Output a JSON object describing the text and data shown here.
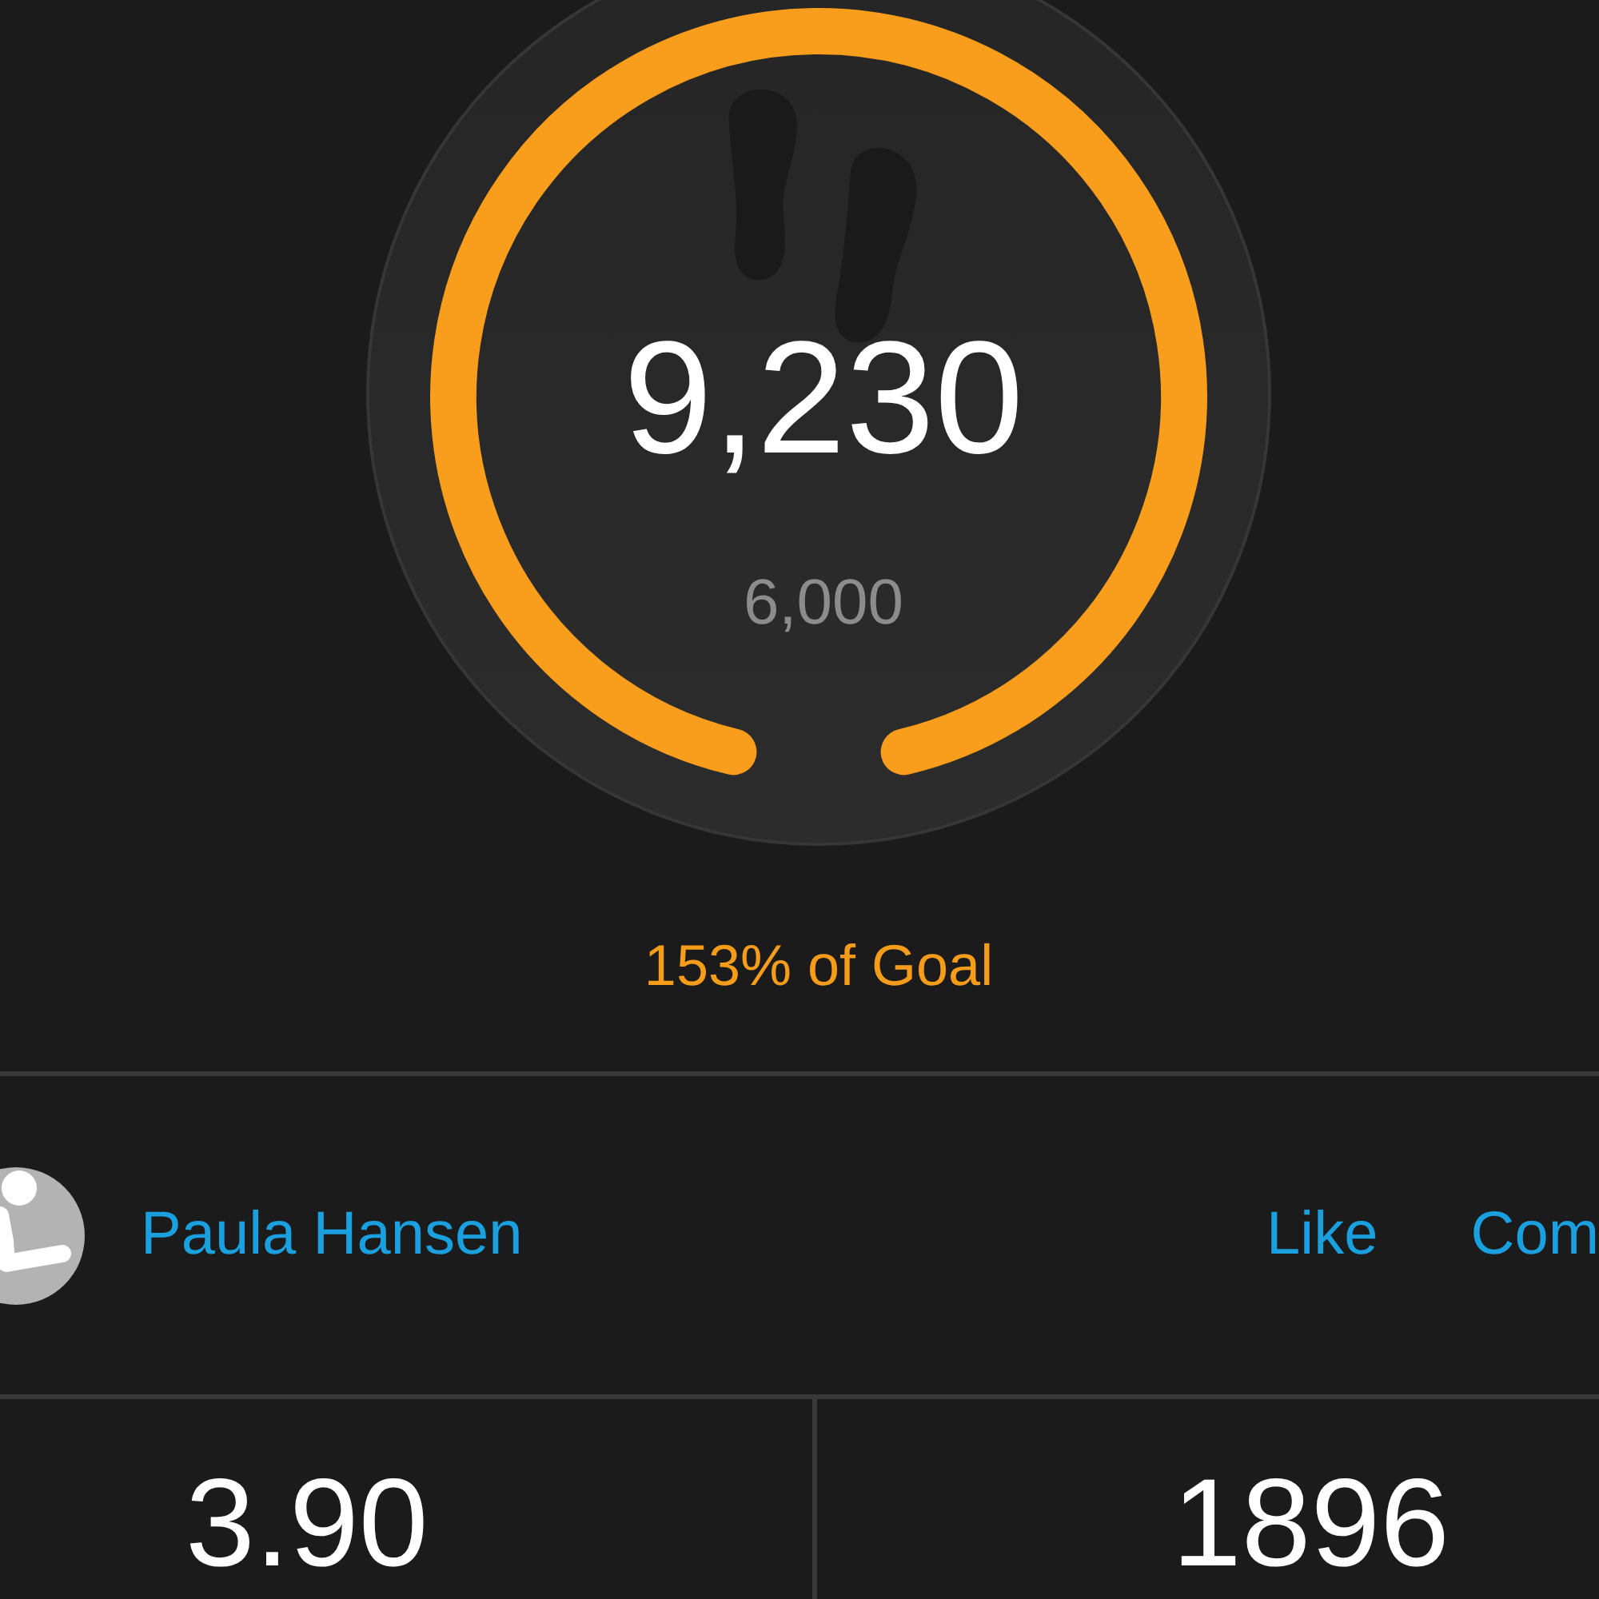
{
  "steps_gauge": {
    "steps": "9,230",
    "goal": "6,000"
  },
  "goal_progress": "153% of Goal",
  "activity": {
    "user_name": "Paula Hansen",
    "actions": [
      "Like",
      "Com"
    ]
  },
  "stats": [
    {
      "value": "3.90"
    },
    {
      "value": "1896"
    }
  ]
}
